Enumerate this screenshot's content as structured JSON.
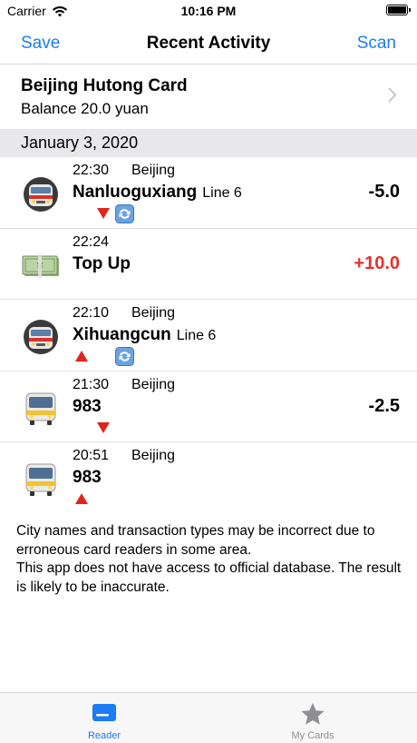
{
  "status_bar": {
    "carrier": "Carrier",
    "time": "10:16 PM"
  },
  "nav": {
    "left_button": "Save",
    "title": "Recent Activity",
    "right_button": "Scan"
  },
  "card": {
    "name": "Beijing Hutong Card",
    "balance": "Balance 20.0 yuan"
  },
  "section": {
    "date": "January 3, 2020"
  },
  "transactions": [
    {
      "icon": "metro-train-icon",
      "time": "22:30",
      "city": "Beijing",
      "name": "Nanluoguxiang",
      "line": "Line 6",
      "amount": "-5.0",
      "direction": "exit",
      "transfer": true
    },
    {
      "icon": "money-banknote-icon",
      "time": "22:24",
      "city": "",
      "name": "Top Up",
      "line": "",
      "amount": "+10.0",
      "direction": "",
      "transfer": false
    },
    {
      "icon": "metro-train-icon",
      "time": "22:10",
      "city": "Beijing",
      "name": "Xihuangcun",
      "line": "Line 6",
      "amount": "",
      "direction": "entry",
      "transfer": true
    },
    {
      "icon": "bus-icon",
      "time": "21:30",
      "city": "Beijing",
      "name": "983",
      "line": "",
      "amount": "-2.5",
      "direction": "exit",
      "transfer": false
    },
    {
      "icon": "bus-icon",
      "time": "20:51",
      "city": "Beijing",
      "name": "983",
      "line": "",
      "amount": "",
      "direction": "entry",
      "transfer": false
    }
  ],
  "notice": {
    "line1": "City names and transaction types may be incorrect due to erroneous card readers in some area.",
    "line2": "This app does not have access to official database. The result is likely to be inaccurate."
  },
  "tabs": [
    {
      "label": "Reader",
      "icon": "card-icon",
      "selected": true
    },
    {
      "label": "My Cards",
      "icon": "star-icon",
      "selected": false
    }
  ],
  "colors": {
    "accent": "#1a7cf5",
    "positive_amount": "#e8302a",
    "section_bg": "#e8e8ea"
  }
}
